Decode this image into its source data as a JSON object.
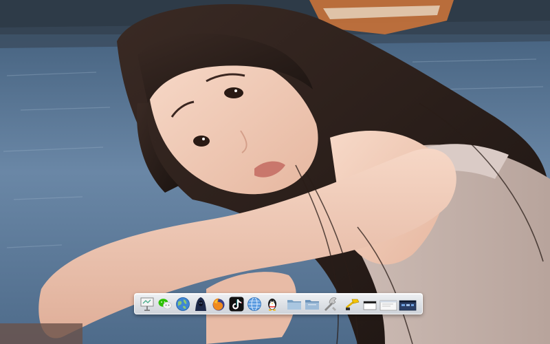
{
  "desktop": {
    "wallpaper": {
      "subject": "woman-resting-on-arm-by-water",
      "colors": {
        "water": "#5a7897",
        "water_light": "#8ea6bf",
        "skin": "#efc8b4",
        "skin_shadow": "#d8a892",
        "hair": "#2b211d",
        "top": "#c9b8b2",
        "boat": "#c9733a"
      }
    }
  },
  "dock": {
    "background": "#dde1e6",
    "items": [
      {
        "id": "presentation",
        "icon": "presentation-board-icon"
      },
      {
        "id": "wechat",
        "icon": "wechat-icon"
      },
      {
        "id": "browser-globe",
        "icon": "globe-browser-icon"
      },
      {
        "id": "hooded-app",
        "icon": "hooded-figure-icon"
      },
      {
        "id": "firefox",
        "icon": "firefox-icon"
      },
      {
        "id": "tiktok",
        "icon": "tiktok-icon"
      },
      {
        "id": "network-globe",
        "icon": "network-globe-icon"
      },
      {
        "id": "qq",
        "icon": "qq-penguin-icon"
      },
      {
        "id": "folder-1",
        "icon": "folder-icon"
      },
      {
        "id": "folder-2",
        "icon": "folder-icon"
      },
      {
        "id": "utilities",
        "icon": "tools-icon"
      },
      {
        "id": "terminal-tool",
        "icon": "terminal-tool-icon"
      },
      {
        "id": "window-1",
        "icon": "window-thumbnail-icon"
      },
      {
        "id": "window-2",
        "icon": "window-thumbnail-icon"
      },
      {
        "id": "window-3",
        "icon": "window-thumbnail-icon"
      }
    ]
  }
}
